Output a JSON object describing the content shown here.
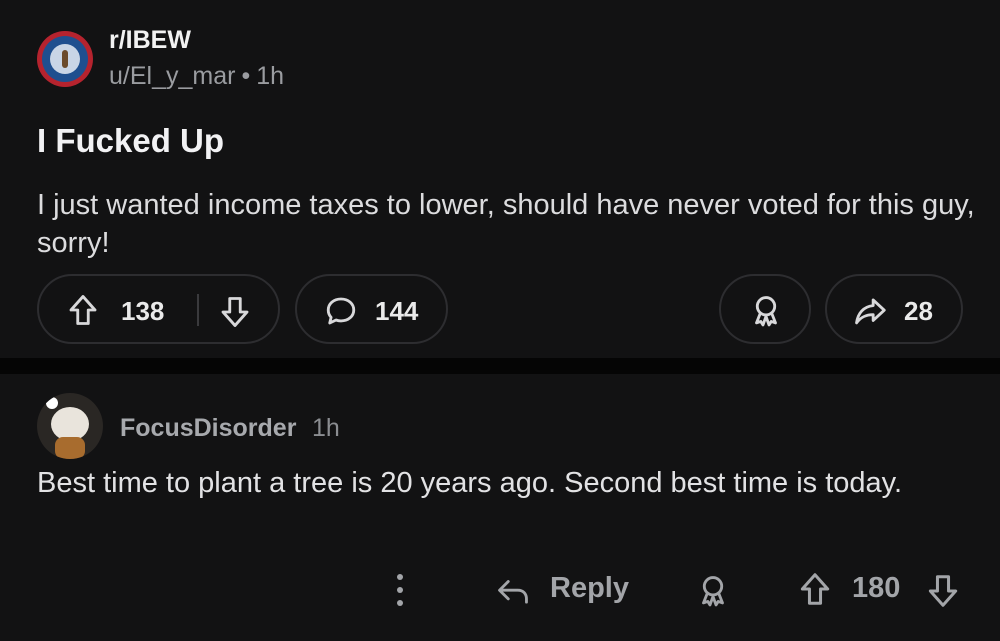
{
  "post": {
    "subreddit": "r/IBEW",
    "author": "u/El_y_mar",
    "separator": "•",
    "time": "1h",
    "title": "I Fucked Up",
    "body": "I just wanted income taxes to lower, should have never voted for this guy, sorry!",
    "upvotes": "138",
    "comments": "144",
    "shares": "28"
  },
  "comment": {
    "author": "FocusDisorder",
    "time": "1h",
    "text": "Best time to plant a tree is 20 years ago. Second best time is today.",
    "reply_label": "Reply",
    "votes": "180"
  },
  "icons": {
    "upvote": "arrow-up-outline-icon",
    "downvote": "arrow-down-outline-icon",
    "comment": "speech-bubble-icon",
    "award": "award-ribbon-icon",
    "share": "share-arrow-icon",
    "reply": "reply-arrow-icon",
    "more": "vertical-dots-icon"
  },
  "colors": {
    "background": "#0b0b0c",
    "card": "#121213",
    "text": "#e8e8ea",
    "muted": "#9a9ca0",
    "subreddit_avatar": "#b5232e"
  }
}
